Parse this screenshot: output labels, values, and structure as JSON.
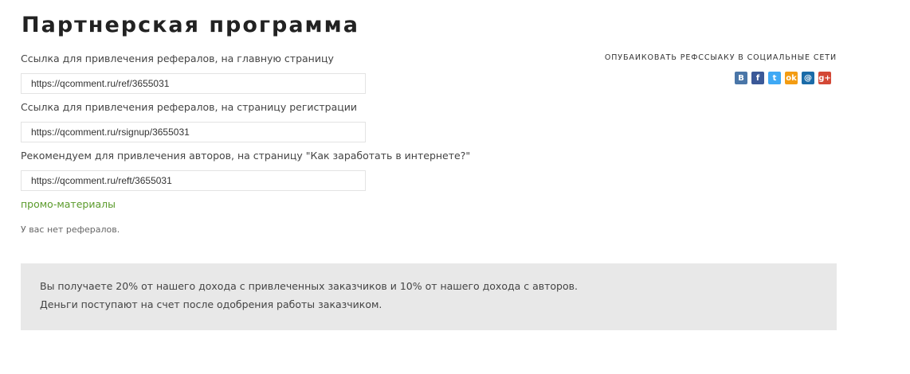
{
  "page": {
    "title": "Партнерская программа"
  },
  "referral_links": [
    {
      "label": "Ссылка для привлечения рефералов, на главную страницу",
      "value": "https://qcomment.ru/ref/3655031"
    },
    {
      "label": "Ссылка для привлечения рефералов, на страницу регистрации",
      "value": "https://qcomment.ru/rsignup/3655031"
    },
    {
      "label": "Рекомендуем для привлечения авторов, на страницу \"Как заработать в интернете?\"",
      "value": "https://qcomment.ru/reft/3655031"
    }
  ],
  "promo_link": "промо-материалы",
  "referrals_status": "У вас нет рефералов.",
  "share": {
    "title": "ОПУБАИКОВАТЬ РЕФССЫАКУ В СОЦИАЛЬНЫЕ СЕТИ",
    "networks": [
      {
        "name": "vkontakte",
        "glyph": "В",
        "color": "#4a76a8"
      },
      {
        "name": "facebook",
        "glyph": "f",
        "color": "#3b5998"
      },
      {
        "name": "twitter",
        "glyph": "t",
        "color": "#3fa9f5"
      },
      {
        "name": "odnoklassniki",
        "glyph": "ok",
        "color": "#f39c12"
      },
      {
        "name": "mail-ru",
        "glyph": "@",
        "color": "#1a6ba8"
      },
      {
        "name": "google-plus",
        "glyph": "g+",
        "color": "#d34836"
      }
    ]
  },
  "info": {
    "line1": "Вы получаете 20% от нашего дохода с привлеченных заказчиков и 10% от нашего дохода с авторов.",
    "line2": "Деньги поступают на счет после одобрения работы заказчиком."
  }
}
